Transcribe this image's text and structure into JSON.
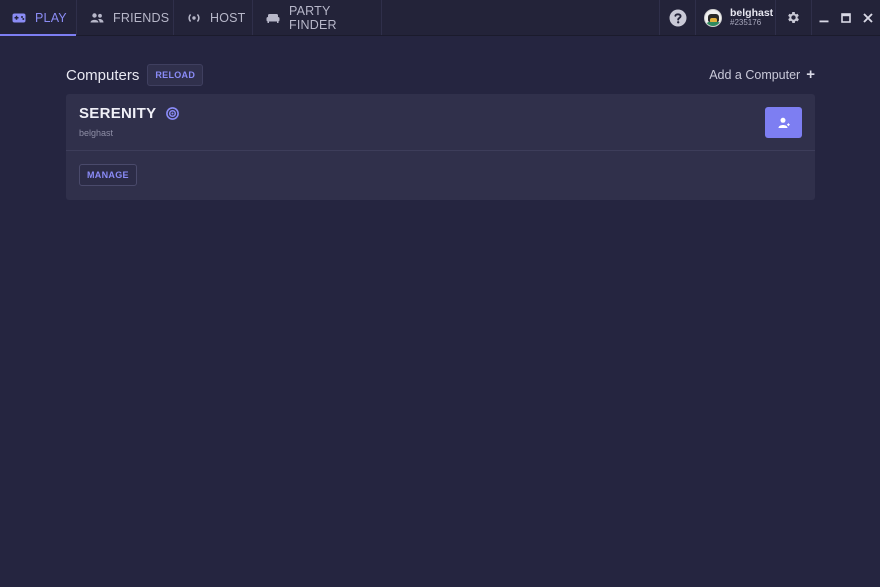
{
  "colors": {
    "background": "#252540",
    "titlebar": "#232339",
    "accent": "#7d7ef2",
    "card": "#30304b"
  },
  "tabs": [
    {
      "label": "PLAY",
      "icon": "gamepad-icon",
      "active": true
    },
    {
      "label": "FRIENDS",
      "icon": "people-icon",
      "active": false
    },
    {
      "label": "HOST",
      "icon": "broadcast-icon",
      "active": false
    },
    {
      "label": "PARTY FINDER",
      "icon": "couch-icon",
      "active": false
    }
  ],
  "titlebar": {
    "help_icon": "help-icon",
    "settings_icon": "gear-icon",
    "user": {
      "name": "belghast",
      "tag": "#235176"
    },
    "window_controls": [
      "minimize-icon",
      "maximize-icon",
      "close-icon"
    ]
  },
  "computers": {
    "title": "Computers",
    "reload_label": "RELOAD",
    "add_label": "Add a Computer",
    "add_symbol": "+",
    "items": [
      {
        "name": "SERENITY",
        "owner": "belghast",
        "status_icon": "broadcast-status-icon",
        "action_icon": "add-user-icon",
        "manage_label": "MANAGE"
      }
    ]
  }
}
